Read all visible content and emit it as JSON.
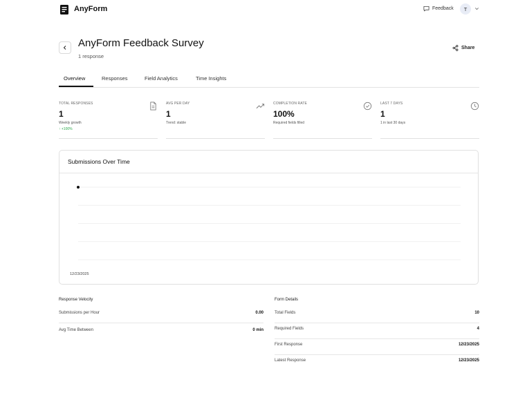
{
  "app": {
    "brand": "AnyForm",
    "feedback_label": "Feedback",
    "user_initial": "T"
  },
  "header": {
    "title": "AnyForm Feedback Survey",
    "subtitle": "1 response",
    "share_label": "Share"
  },
  "tabs": [
    {
      "label": "Overview",
      "active": true
    },
    {
      "label": "Responses",
      "active": false
    },
    {
      "label": "Field Analytics",
      "active": false
    },
    {
      "label": "Time Insights",
      "active": false
    }
  ],
  "stats": [
    {
      "label": "TOTAL RESPONSES",
      "value": "1",
      "sub": "Weekly growth",
      "trend": "↑ +100%",
      "icon": "document-icon"
    },
    {
      "label": "AVG PER DAY",
      "value": "1",
      "sub": "Trend: stable",
      "icon": "trending-up-icon"
    },
    {
      "label": "COMPLETION RATE",
      "value": "100%",
      "sub": "Required fields filled",
      "icon": "check-circle-icon"
    },
    {
      "label": "LAST 7 DAYS",
      "value": "1",
      "sub": "1 in last 30 days",
      "icon": "clock-icon"
    }
  ],
  "chart": {
    "title": "Submissions Over Time"
  },
  "chart_data": {
    "type": "line",
    "x": [
      "12/23/2025"
    ],
    "series": [
      {
        "values": [
          1
        ]
      }
    ],
    "xlabel": "",
    "ylabel": "",
    "grid": true,
    "legend": "none"
  },
  "velocity": {
    "title": "Response Velocity",
    "rows": [
      {
        "label": "Submissions per Hour",
        "value": "0.00"
      },
      {
        "label": "Avg Time Between",
        "value": "0 min"
      }
    ]
  },
  "form_details": {
    "title": "Form Details",
    "rows": [
      {
        "label": "Total Fields",
        "value": "10"
      },
      {
        "label": "Required Fields",
        "value": "4"
      },
      {
        "label": "First Response",
        "value": "12/23/2025"
      },
      {
        "label": "Latest Response",
        "value": "12/23/2025"
      }
    ]
  },
  "colors": {
    "accent": "#111111",
    "trend_positive": "#2aa84a",
    "border": "#e0e0e0"
  }
}
